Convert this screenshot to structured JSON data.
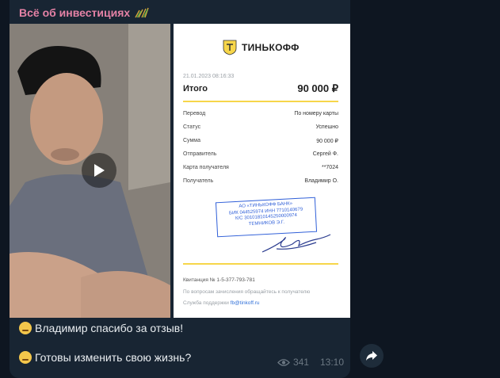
{
  "channel": {
    "title": "Всё об инвестициях",
    "icon": "chart-growth-icon"
  },
  "receipt": {
    "brand": "ТИНЬКОФФ",
    "datetime": "21.01.2023  08:16:33",
    "total_label": "Итого",
    "total_value": "90 000 ₽",
    "rows": [
      {
        "label": "Перевод",
        "value": "По номеру карты"
      },
      {
        "label": "Статус",
        "value": "Успешно"
      },
      {
        "label": "Сумма",
        "value": "90 000 ₽"
      },
      {
        "label": "Отправитель",
        "value": "Сергей Ф."
      },
      {
        "label": "Карта получателя",
        "value": "**7024"
      },
      {
        "label": "Получатель",
        "value": "Владимир О."
      }
    ],
    "stamp": [
      "АО «ТИНЬКОФФ БАНК»",
      "БИК 044525974  ИНН 7710140679",
      "К/С 30101810145250000974",
      "ТЕМНИКОВ Э.Г."
    ],
    "receipt_number": "Квитанция  № 1-5-377-793-781",
    "questions": "По вопросам зачисления обращайтесь к получателю",
    "support_label": "Служба поддержки",
    "support_email": "fb@tinkoff.ru"
  },
  "message": {
    "line1": "Владимир спасибо за отзыв!",
    "line2": "Готовы изменить свою жизнь?",
    "views": "341",
    "time": "13:10"
  },
  "colors": {
    "background": "#0e1621",
    "bubble": "#182533",
    "channel_name": "#e582a6",
    "accent_yellow": "#f7d64a",
    "stamp_blue": "#2f5fd8"
  }
}
